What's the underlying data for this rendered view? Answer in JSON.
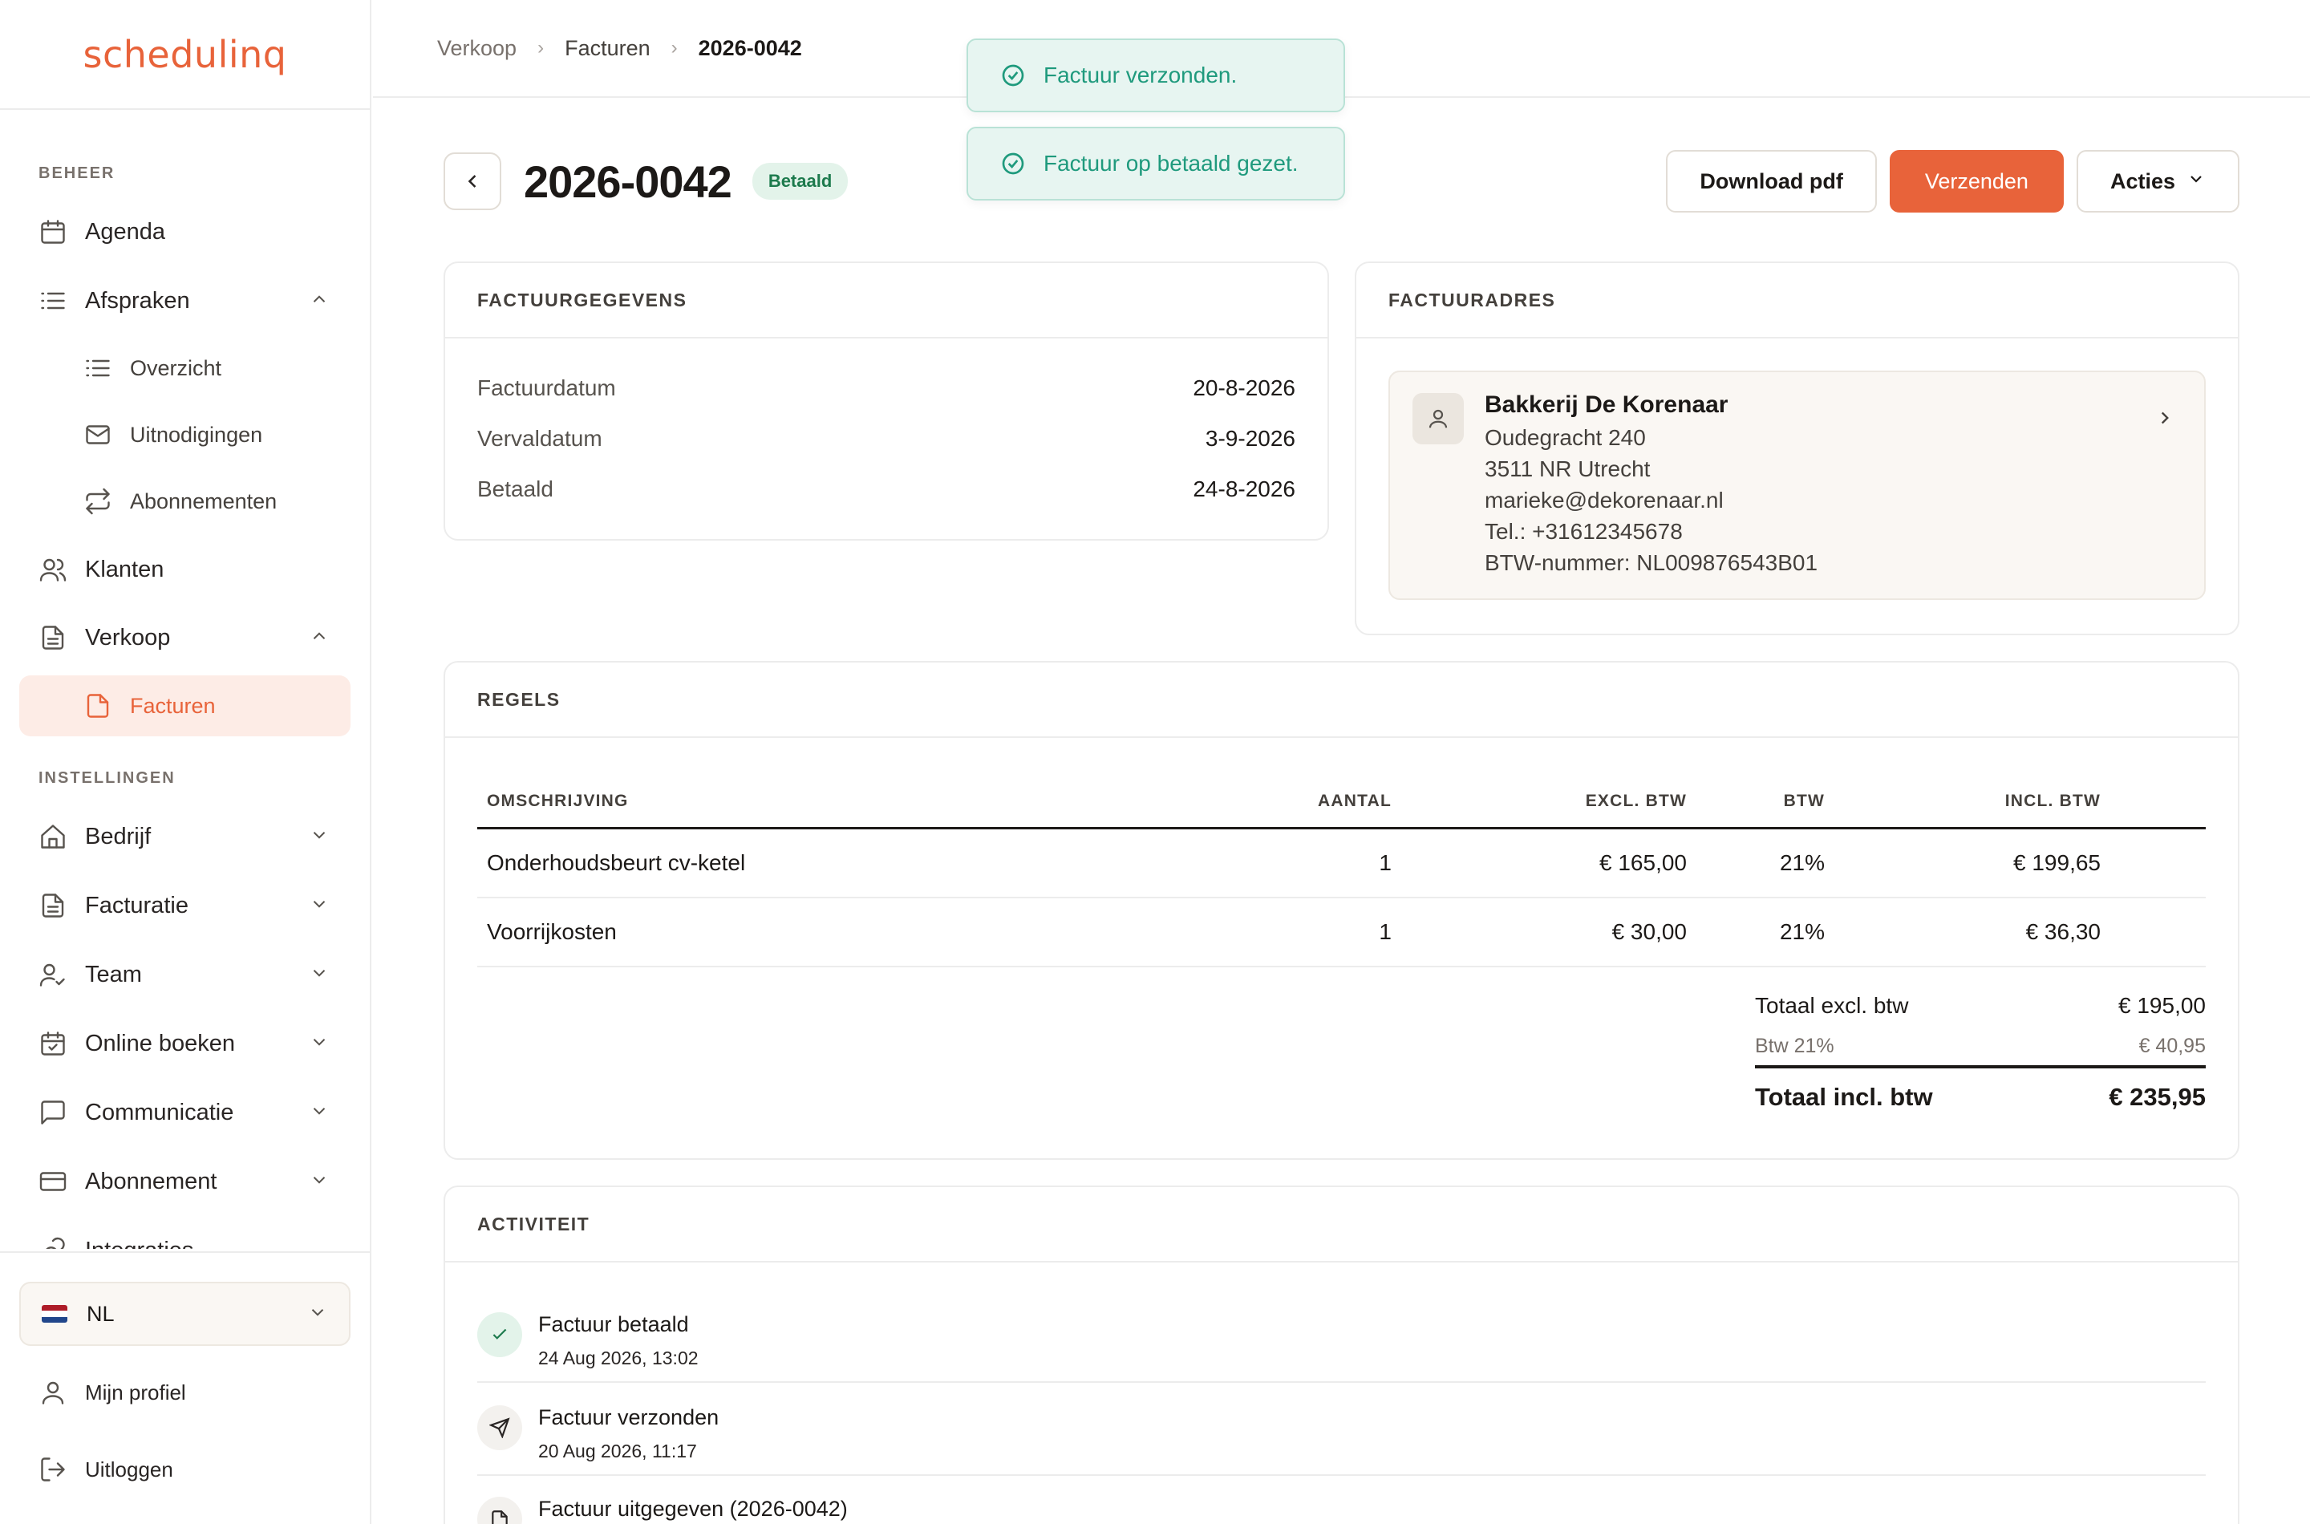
{
  "brand": {
    "logo_text": "schedulinq",
    "accent": "#e8633a"
  },
  "sidebar": {
    "section_beheer": "BEHEER",
    "section_instellingen": "INSTELLINGEN",
    "items": [
      {
        "label": "Agenda",
        "icon": "calendar-icon"
      },
      {
        "label": "Afspraken",
        "icon": "list-icon"
      },
      {
        "label": "Overzicht",
        "icon": "list-icon"
      },
      {
        "label": "Uitnodigingen",
        "icon": "mail-icon"
      },
      {
        "label": "Abonnementen",
        "icon": "repeat-icon"
      },
      {
        "label": "Klanten",
        "icon": "users-icon"
      },
      {
        "label": "Verkoop",
        "icon": "document-icon"
      },
      {
        "label": "Facturen",
        "icon": "document-icon"
      },
      {
        "label": "Bedrijf",
        "icon": "home-icon"
      },
      {
        "label": "Facturatie",
        "icon": "document-icon"
      },
      {
        "label": "Team",
        "icon": "user-check-icon"
      },
      {
        "label": "Online boeken",
        "icon": "calendar-check-icon"
      },
      {
        "label": "Communicatie",
        "icon": "chat-icon"
      },
      {
        "label": "Abonnement",
        "icon": "credit-card-icon"
      },
      {
        "label": "Integraties",
        "icon": "link-icon"
      }
    ],
    "language": "NL",
    "profile": "Mijn profiel",
    "logout": "Uitloggen"
  },
  "breadcrumb": [
    "Verkoop",
    "Facturen",
    "2026-0042"
  ],
  "toasts": [
    "Factuur verzonden.",
    "Factuur op betaald gezet."
  ],
  "header": {
    "title": "2026-0042",
    "status": "Betaald",
    "download": "Download pdf",
    "send": "Verzenden",
    "actions": "Acties"
  },
  "details": {
    "heading": "FACTUURGEGEVENS",
    "rows": [
      {
        "label": "Factuurdatum",
        "value": "20-8-2026"
      },
      {
        "label": "Vervaldatum",
        "value": "3-9-2026"
      },
      {
        "label": "Betaald",
        "value": "24-8-2026"
      }
    ]
  },
  "address": {
    "heading": "FACTUURADRES",
    "name": "Bakkerij De Korenaar",
    "lines": [
      "Oudegracht 240",
      "3511 NR Utrecht",
      "marieke@dekorenaar.nl",
      "Tel.: +31612345678",
      "BTW-nummer: NL009876543B01"
    ]
  },
  "lines": {
    "heading": "REGELS",
    "columns": [
      "OMSCHRIJVING",
      "AANTAL",
      "EXCL. BTW",
      "BTW",
      "INCL. BTW"
    ],
    "rows": [
      [
        "Onderhoudsbeurt cv-ketel",
        "1",
        "€ 165,00",
        "21%",
        "€ 199,65"
      ],
      [
        "Voorrijkosten",
        "1",
        "€ 30,00",
        "21%",
        "€ 36,30"
      ]
    ],
    "totals": {
      "excl_label": "Totaal excl. btw",
      "excl_value": "€ 195,00",
      "vat_label": "Btw 21%",
      "vat_value": "€ 40,95",
      "incl_label": "Totaal incl. btw",
      "incl_value": "€ 235,95"
    }
  },
  "activity": {
    "heading": "ACTIVITEIT",
    "items": [
      {
        "title": "Factuur betaald",
        "date": "24 Aug 2026, 13:02",
        "icon": "check-icon"
      },
      {
        "title": "Factuur verzonden",
        "date": "20 Aug 2026, 11:17",
        "icon": "send-icon"
      },
      {
        "title": "Factuur uitgegeven (2026-0042)",
        "date": "",
        "icon": "document-icon"
      }
    ]
  }
}
